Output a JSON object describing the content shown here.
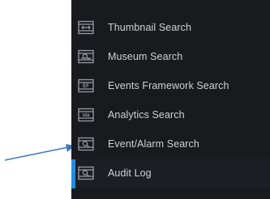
{
  "colors": {
    "menu_background": "#191a1e",
    "menu_text": "#d0d1d4",
    "icon_color": "#9a9ca2",
    "active_indicator": "#1c8ee6",
    "arrow_color": "#3f78c1"
  },
  "menu": {
    "items": [
      {
        "label": "Thumbnail Search",
        "icon": "thumbnail-search-icon",
        "active": false
      },
      {
        "label": "Museum Search",
        "icon": "museum-search-icon",
        "active": false
      },
      {
        "label": "Events Framework Search",
        "icon": "events-framework-icon",
        "active": false
      },
      {
        "label": "Analytics Search",
        "icon": "analytics-search-icon",
        "active": false
      },
      {
        "label": "Event/Alarm Search",
        "icon": "event-alarm-search-icon",
        "active": false
      },
      {
        "label": "Audit Log",
        "icon": "audit-log-icon",
        "active": true
      }
    ],
    "icon_texts": {
      "events_framework": "EF",
      "analytics": "sta"
    }
  }
}
